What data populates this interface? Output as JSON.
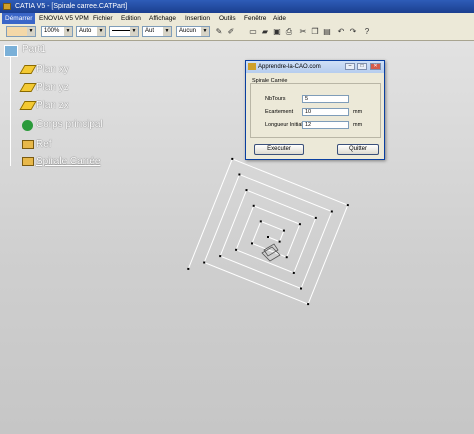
{
  "window": {
    "title": "CATIA V5 - [Spirale carree.CATPart]"
  },
  "menubar": {
    "items": [
      "Démarrer",
      "ENOVIA V5 VPM",
      "Fichier",
      "Edition",
      "Affichage",
      "Insertion",
      "Outils",
      "Fenêtre",
      "Aide"
    ]
  },
  "toolbar": {
    "zoom": "100%",
    "linetype": "Auto",
    "thickness": "Aut",
    "layer": "Aucun"
  },
  "tree": {
    "root": "Part1",
    "items": [
      "Plan xy",
      "Plan yz",
      "Plan zx",
      "Corps principal",
      "Ref",
      "Spirale Carrée"
    ]
  },
  "dialog": {
    "title": "Apprendre-la-CAO.com",
    "group_label": "Spirale Carrée",
    "fields": [
      {
        "label": "NbTours",
        "value": "5",
        "unit": ""
      },
      {
        "label": "Ecartement",
        "value": "10",
        "unit": "mm"
      },
      {
        "label": "Longueur Initiale",
        "value": "12",
        "unit": "mm"
      }
    ],
    "execute_label": "Executer",
    "quit_label": "Quitter",
    "minimize_glyph": "–",
    "maximize_glyph": "□",
    "close_glyph": "✕"
  },
  "colors": {
    "titlebar": "#1b3f8f",
    "tree_text": "#ffffff",
    "plane_icon": "#f3c933"
  }
}
